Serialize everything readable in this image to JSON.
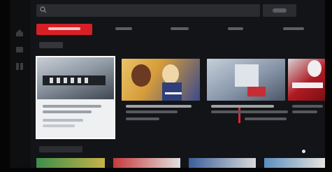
{
  "screen": {
    "background": "#131417"
  },
  "search": {
    "placeholder": "",
    "icon": "search-icon"
  },
  "tabs": [
    {
      "label": "",
      "active": true
    },
    {
      "label": "",
      "active": false
    },
    {
      "label": "",
      "active": false
    },
    {
      "label": "",
      "active": false
    },
    {
      "label": "",
      "active": false
    }
  ],
  "section": {
    "title": ""
  },
  "cards": [
    {
      "title": "",
      "subtitle": "",
      "focused": true,
      "thumb_colors": [
        "#c9cfd6",
        "#3f4650"
      ]
    },
    {
      "title": "",
      "subtitle": "",
      "focused": false,
      "thumb_colors": [
        "#e8c36a",
        "#3b4a8a"
      ]
    },
    {
      "title": "",
      "subtitle": "",
      "focused": false,
      "thumb_colors": [
        "#a8b3c4",
        "#c62d34"
      ]
    },
    {
      "title": "",
      "subtitle": "",
      "focused": false,
      "thumb_colors": [
        "#b01a22",
        "#f0eef0"
      ]
    }
  ],
  "colors": {
    "accent": "#d81f26",
    "focus": "#ffffff"
  }
}
